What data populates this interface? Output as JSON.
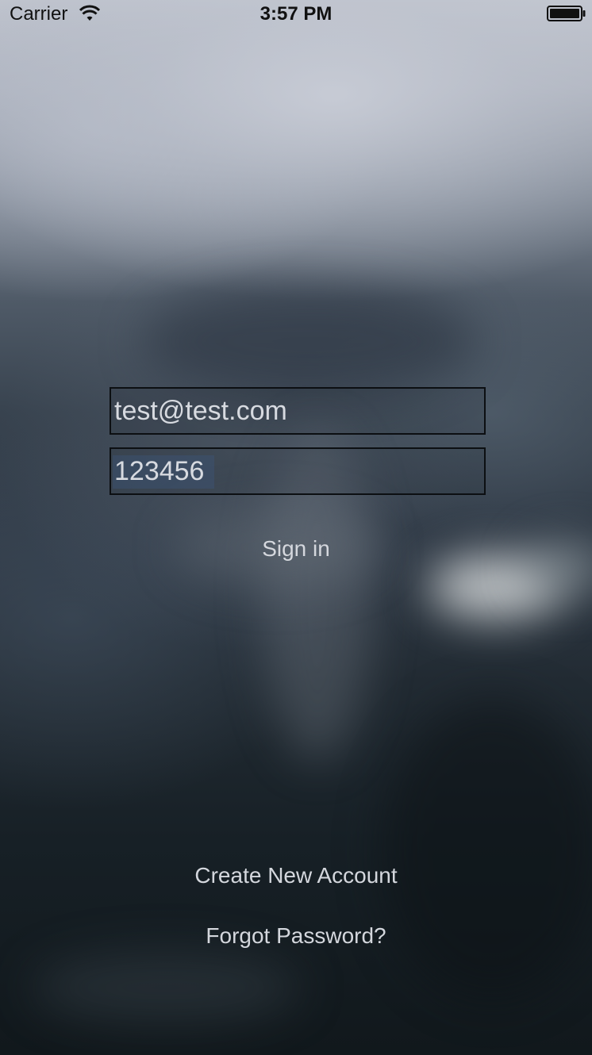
{
  "status_bar": {
    "carrier": "Carrier",
    "time": "3:57 PM",
    "wifi_icon": "wifi-icon",
    "battery_icon": "battery-icon"
  },
  "login": {
    "email_value": "test@test.com",
    "password_value": "123456",
    "sign_in_label": "Sign in"
  },
  "footer": {
    "create_account_label": "Create New Account",
    "forgot_password_label": "Forgot Password?"
  },
  "colors": {
    "text": "#d4d7dd",
    "field_border": "#0c0f12",
    "status_text": "#111111"
  }
}
